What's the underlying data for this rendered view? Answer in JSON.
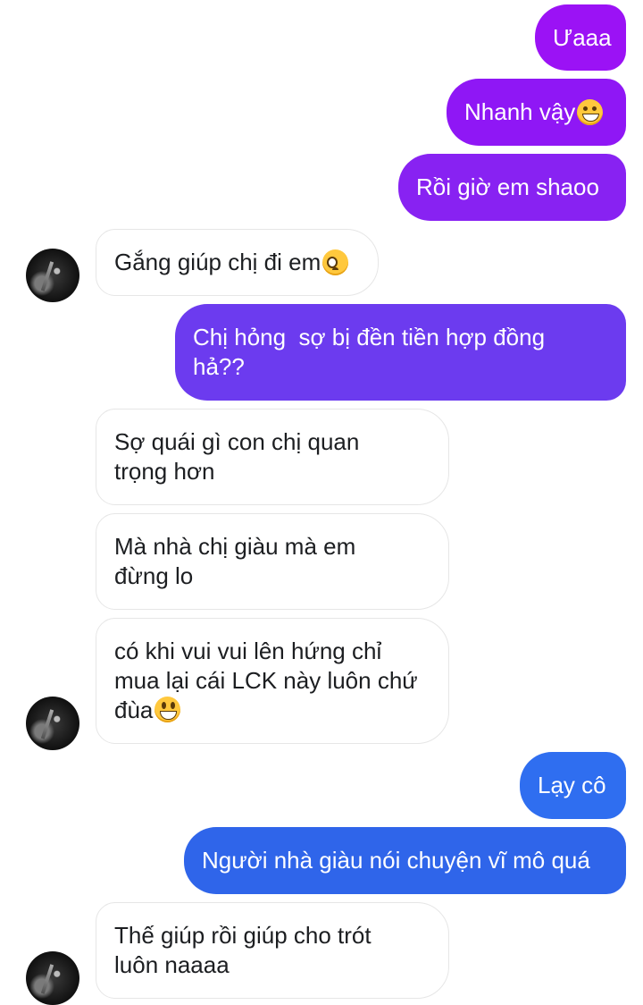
{
  "colors": {
    "out_1": "#9b12f5",
    "out_2": "#8e17f5",
    "out_3": "#8422ef",
    "out_4": "#6c3bef",
    "out_5": "#2f6ef0",
    "out_6": "#2f65ea"
  },
  "messages": [
    {
      "side": "sent",
      "text": "Ưaaa"
    },
    {
      "side": "sent",
      "text": "Nhanh vậy",
      "emoji": "grinning-emoji"
    },
    {
      "side": "sent",
      "text": "Rồi giờ em shaoo"
    },
    {
      "side": "received",
      "text": "Gắng giúp chị đi em",
      "emoji": "pleading-emoji"
    },
    {
      "side": "sent",
      "text": "Chị hỏng  sợ bị đền tiền hợp đồng\nhả??"
    },
    {
      "side": "received",
      "text": "Sợ quái gì con chị quan\ntrọng hơn"
    },
    {
      "side": "received",
      "text": "Mà nhà chị giàu mà em\nđừng lo"
    },
    {
      "side": "received",
      "text": "có khi vui vui lên hứng chỉ\nmua lại cái LCK này luôn chứ\nđùa",
      "emoji": "smiley-emoji"
    },
    {
      "side": "sent",
      "text": "Lạy cô"
    },
    {
      "side": "sent",
      "text": "Người nhà giàu nói chuyện vĩ mô quá"
    },
    {
      "side": "received",
      "text": "Thế giúp rồi giúp cho trót\nluôn naaaa"
    }
  ]
}
